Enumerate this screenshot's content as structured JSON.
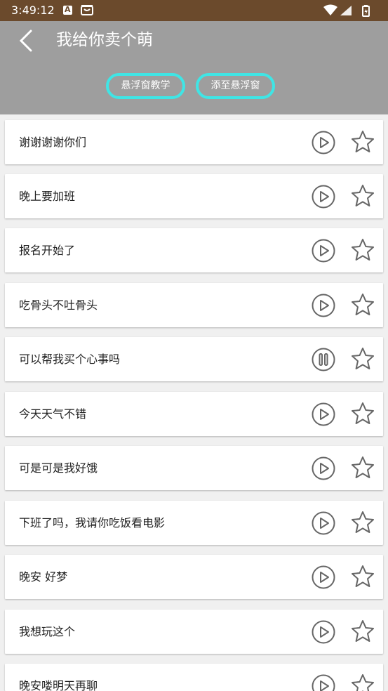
{
  "status_bar": {
    "time": "3:49:12"
  },
  "header": {
    "title": "我给你卖个萌",
    "tutorial_button": "悬浮窗教学",
    "add_button": "添至悬浮窗"
  },
  "colors": {
    "status_bar": "#6b4a2c",
    "header": "#9e9e9e",
    "button_border": "#3fe5e5",
    "icon": "#666666"
  },
  "items": [
    {
      "text": "谢谢谢谢你们",
      "state": "play"
    },
    {
      "text": "晚上要加班",
      "state": "play"
    },
    {
      "text": "报名开始了",
      "state": "play"
    },
    {
      "text": "吃骨头不吐骨头",
      "state": "play"
    },
    {
      "text": "可以帮我买个心事吗",
      "state": "pause"
    },
    {
      "text": "今天天气不错",
      "state": "play"
    },
    {
      "text": "可是可是我好饿",
      "state": "play"
    },
    {
      "text": "下班了吗，我请你吃饭看电影",
      "state": "play"
    },
    {
      "text": "晚安 好梦",
      "state": "play"
    },
    {
      "text": "我想玩这个",
      "state": "play"
    },
    {
      "text": "晚安喽明天再聊",
      "state": "play"
    }
  ]
}
